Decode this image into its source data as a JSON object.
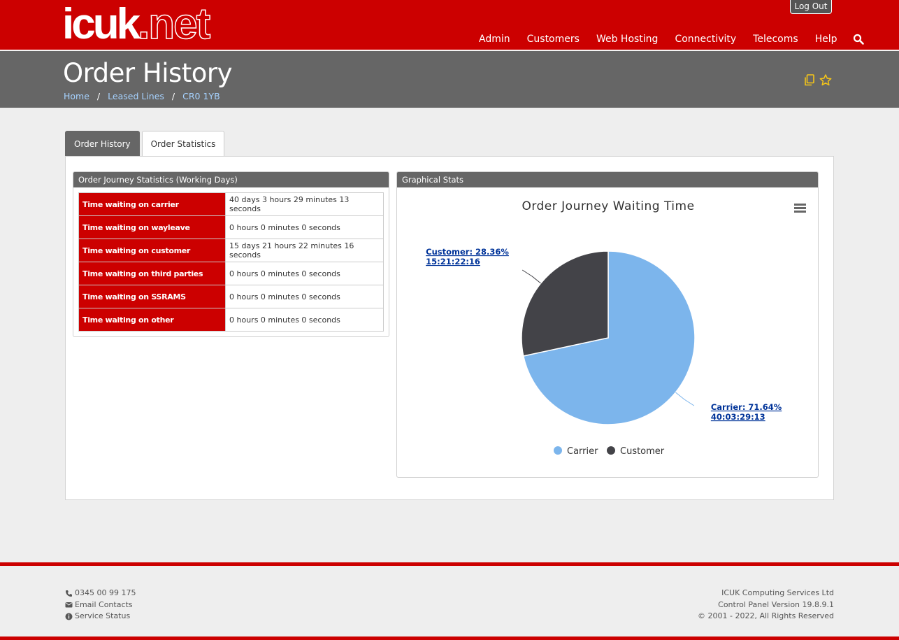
{
  "header": {
    "logo_main": "icuk",
    "logo_suffix": ".net",
    "logout_label": "Log Out",
    "nav": [
      "Admin",
      "Customers",
      "Web Hosting",
      "Connectivity",
      "Telecoms",
      "Help"
    ]
  },
  "titlebar": {
    "title": "Order History",
    "breadcrumb": [
      "Home",
      "Leased Lines",
      "CR0 1YB"
    ]
  },
  "tabs": [
    "Order History",
    "Order Statistics"
  ],
  "stats": {
    "heading": "Order Journey Statistics (Working Days)",
    "rows": [
      {
        "label": "Time waiting on carrier",
        "value": "40 days 3 hours 29 minutes 13 seconds"
      },
      {
        "label": "Time waiting on wayleave",
        "value": "0 hours 0 minutes 0 seconds"
      },
      {
        "label": "Time waiting on customer",
        "value": "15 days 21 hours 22 minutes 16 seconds"
      },
      {
        "label": "Time waiting on third parties",
        "value": "0 hours 0 minutes 0 seconds"
      },
      {
        "label": "Time waiting on SSRAMS",
        "value": "0 hours 0 minutes 0 seconds"
      },
      {
        "label": "Time waiting on other",
        "value": "0 hours 0 minutes 0 seconds"
      }
    ]
  },
  "graph": {
    "heading": "Graphical Stats"
  },
  "chart_data": {
    "type": "pie",
    "title": "Order Journey Waiting Time",
    "slices": [
      {
        "name": "Carrier",
        "percent": 71.64,
        "time": "40:03:29:13",
        "color": "#7cb5ec",
        "label": "Carrier: 71.64%"
      },
      {
        "name": "Customer",
        "percent": 28.36,
        "time": "15:21:22:16",
        "color": "#434348",
        "label": "Customer: 28.36%"
      }
    ],
    "legend": [
      "Carrier",
      "Customer"
    ],
    "legend_position": "bottom"
  },
  "footer": {
    "phone": "0345 00 99 175",
    "email": "Email Contacts",
    "status": "Service Status",
    "company": "ICUK Computing Services Ltd",
    "version": "Control Panel Version 19.8.9.1",
    "copyright": "© 2001 - 2022, All Rights Reserved"
  },
  "colors": {
    "brand_red": "#cc0000",
    "title_gray": "#666666",
    "link_blue": "#a6d2ff"
  }
}
